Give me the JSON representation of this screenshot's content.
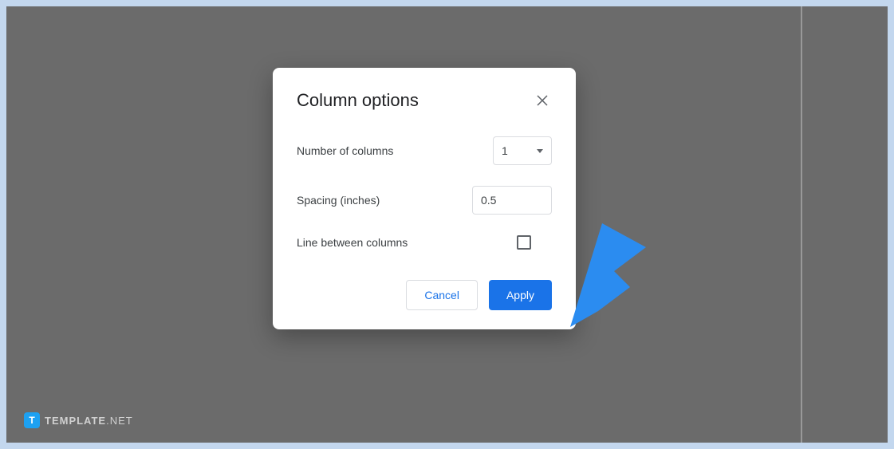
{
  "dialog": {
    "title": "Column options",
    "fields": {
      "columns_label": "Number of columns",
      "columns_value": "1",
      "spacing_label": "Spacing (inches)",
      "spacing_value": "0.5",
      "line_label": "Line between columns"
    },
    "buttons": {
      "cancel": "Cancel",
      "apply": "Apply"
    }
  },
  "watermark": {
    "icon_letter": "T",
    "brand": "TEMPLATE",
    "suffix": ".NET"
  },
  "colors": {
    "accent": "#1a73e8",
    "arrow": "#2b8cf0"
  }
}
